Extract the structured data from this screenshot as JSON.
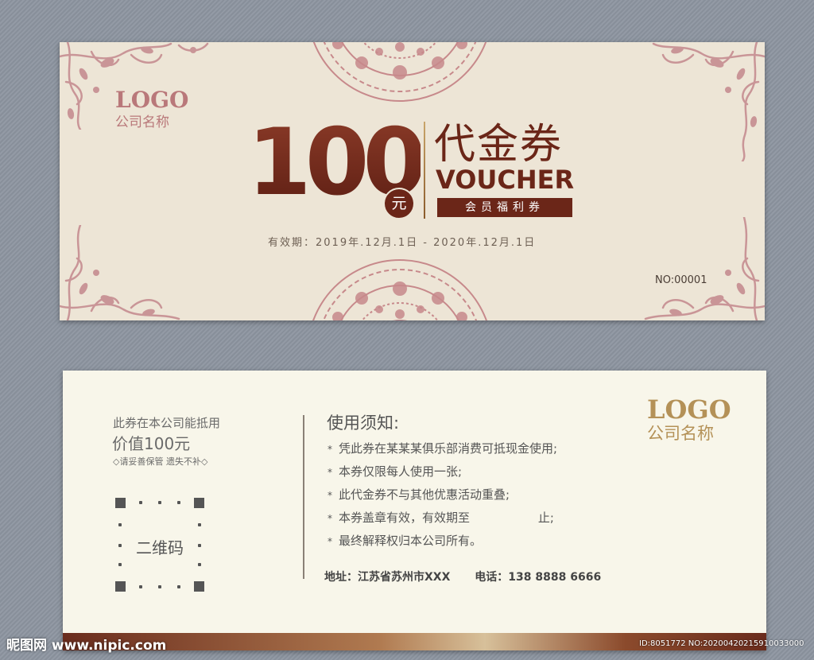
{
  "front": {
    "logo": "LOGO",
    "company": "公司名称",
    "amount": "100",
    "currency_badge": "元",
    "title_cn": "代金券",
    "title_en": "VOUCHER",
    "member_label": "会员福利券",
    "validity": "有效期：2019年.12月.1日 - 2020年.12月.1日",
    "number": "NO:00001"
  },
  "back": {
    "left_line1": "此券在本公司能抵用",
    "left_line2": "价值100元",
    "left_line3": "◇请妥善保管 遗失不补◇",
    "qr_label": "二维码",
    "notice_title": "使用须知:",
    "notice_items": [
      "凭此券在某某某俱乐部消费可抵现金使用;",
      "本券仅限每人使用一张;",
      "此代金券不与其他优惠活动重叠;",
      "本券盖章有效，有效期至                  止;",
      "最终解释权归本公司所有。"
    ],
    "bullet": "*",
    "address_label": "地址：",
    "address_value": "江苏省苏州市XXX",
    "phone_label": "电话：",
    "phone_value": "138 8888 6666",
    "logo": "LOGO",
    "company": "公司名称"
  },
  "watermark": {
    "left": "昵图网 www.nipic.com",
    "right": "ID:8051772 NO:20200420215910033000"
  },
  "colors": {
    "page_bg": "#8d95a0",
    "front_bg": "#ede5d6",
    "back_bg": "#f8f6ea",
    "brown": "#6b2618",
    "ornament_pink": "#c99597",
    "gold": "#b49157"
  },
  "icons": {
    "corner_ornament": "floral-scroll-ornament",
    "medallion": "circular-floral-medallion",
    "qr_placeholder": "qr-code-frame"
  }
}
